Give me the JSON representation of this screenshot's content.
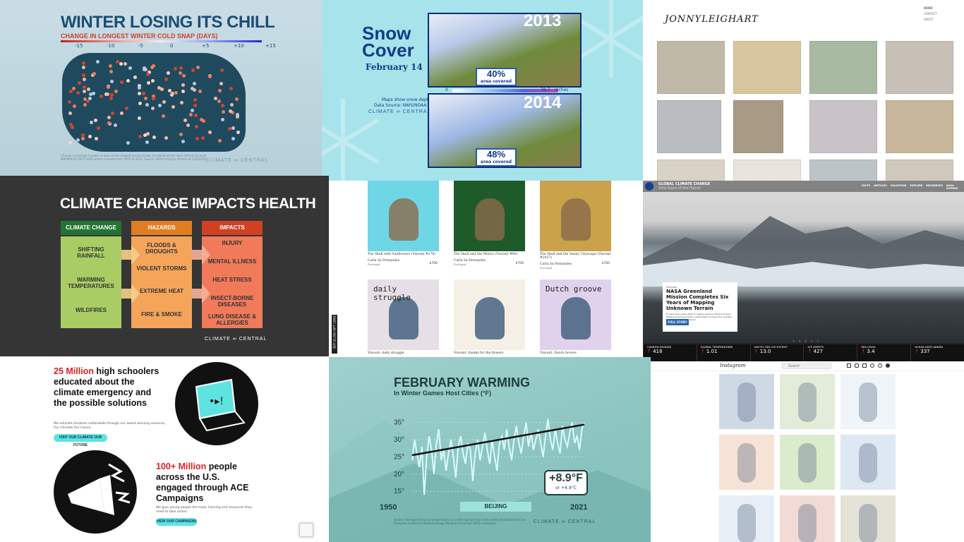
{
  "panel1": {
    "title": "WINTER LOSING ITS CHILL",
    "subtitle": "CHANGE IN LONGEST WINTER COLD SNAP (DAYS)",
    "scale": [
      "-15",
      "-10",
      "-5",
      "0",
      "+5",
      "+10",
      "+15"
    ],
    "note": "Change is average number of days of the longest annual streak of coldest winter days defined by local NORMAL(S) 1971-2020 winter covered from 1970 to 2021. Source: NOAA Analysis Produced 1/20/2022",
    "logo": "CLIMATE ∞ CENTRAL"
  },
  "panel2": {
    "title_line1": "Snow",
    "title_line2": "Cover",
    "date": "February 14",
    "year_top": "2013",
    "pct_top": "40%",
    "pct_top_label": "area covered",
    "legend_min": "0",
    "legend_max": "78.7",
    "legend_unit": "inches",
    "source_line1": "Maps show snow depth",
    "source_line2": "Data Source: NWS/NOAA",
    "logo": "CLIMATE ∞ CENTRAL",
    "year_bottom": "2014",
    "pct_bottom": "48%",
    "pct_bottom_label": "area covered"
  },
  "panel3": {
    "brand": "JONNYLEIGHART",
    "nav": [
      "WORK",
      "CONTACT",
      "ABOUT"
    ]
  },
  "panel4": {
    "title": "CLIMATE CHANGE IMPACTS HEALTH",
    "col1_header": "CLIMATE CHANGE",
    "col1_items": [
      "SHIFTING RAINFALL",
      "WARMING TEMPERATURES",
      "WILDFIRES"
    ],
    "col2_header": "HAZARDS",
    "col2_items": [
      "FLOODS & DROUGHTS",
      "VIOLENT STORMS",
      "EXTREME HEAT",
      "FIRE & SMOKE"
    ],
    "col3_header": "IMPACTS",
    "col3_items": [
      "INJURY",
      "MENTAL ILLNESS",
      "HEAT STRESS",
      "INSECT-BORNE DISEASES",
      "LUNG DISEASE & ALLERGIES"
    ],
    "logo": "CLIMATE ∞ CENTRAL",
    "colors": {
      "green": "#a9cd64",
      "orange": "#f5a55a",
      "red": "#f07a5a"
    }
  },
  "panel5": {
    "side_label": "BUY $1,000 GIFT CARD",
    "items": [
      {
        "title": "The Skull with Sunflowers (Vincent #276)",
        "artist": "Carla Sa Fernandes",
        "country": "Portugal",
        "price": "$700"
      },
      {
        "title": "The Skull and the Matrix (Vincent #80)",
        "artist": "Carla Sa Fernandes",
        "country": "Portugal",
        "price": "$700"
      },
      {
        "title": "The Skull and the Sunny Cityscape (Vincent #2027)",
        "artist": "Carla Sa Fernandes",
        "country": "Portugal",
        "price": "$700"
      },
      {
        "title": "Vincent, daily struggle",
        "artist": "",
        "country": "",
        "price": ""
      },
      {
        "title": "Vincent, thanks for the flowers",
        "artist": "",
        "country": "",
        "price": ""
      },
      {
        "title": "Vincent, Dutch Groove",
        "artist": "",
        "country": "",
        "price": ""
      }
    ],
    "art_text_4": "daily struggle",
    "art_text_6": "Dutch groove"
  },
  "panel6": {
    "site_title": "GLOBAL CLIMATE CHANGE",
    "site_sub": "Vital Signs of the Planet",
    "nav": [
      "FACTS",
      "ARTICLES",
      "SOLUTIONS",
      "EXPLORE",
      "RESOURCES",
      "NASA SCIENCE"
    ],
    "feature_tag": "FEATURES",
    "feature_title": "NASA Greenland Mission Completes Six Years of Mapping Unknown Terrain",
    "feature_body": "To learn how ocean water is melting glaciers, NASA's Oceans Melting Greenland mission extensively surveyed the coastline of the world's largest island.",
    "feature_button": "FULL STORY",
    "stats": [
      {
        "label": "CARBON DIOXIDE",
        "value": "418"
      },
      {
        "label": "GLOBAL TEMPERATURE",
        "value": "1.01"
      },
      {
        "label": "ARCTIC SEA ICE EXTENT",
        "value": "13.0"
      },
      {
        "label": "ICE SHEETS",
        "value": "427"
      },
      {
        "label": "SEA LEVEL",
        "value": "3.4"
      },
      {
        "label": "OCEAN HEAT ADDED",
        "value": "337"
      }
    ]
  },
  "panel7": {
    "stat1_bold": "25 Million",
    "stat1_rest": " high schoolers educated about the climate emergency and the possible solutions",
    "stat1_body": "We educate students nationwide through our award winning resource, Our Climate Our Future.",
    "stat1_button": "VISIT OUR CLIMATE OUR FUTURE",
    "stat2_bold": "100+ Million",
    "stat2_rest": " people across the U.S. engaged through ACE Campaigns",
    "stat2_body": "We give young people the tools, training and resources they need to take action.",
    "stat2_button": "VIEW OUR CAMPAIGNS"
  },
  "panel8": {
    "title": "FEBRUARY WARMING",
    "subtitle": "In Winter Games Host Cities (°F)",
    "city": "BEIJING",
    "change_f": "+8.9°F",
    "change_c": "or +4.9°C",
    "source": "Source: Average February temperatures in winter games host cities were calculated from the European Centre for Medium-Range Weather Forecasts' ERA5 reanalysis.",
    "logo": "CLIMATE ∞ CENTRAL",
    "chart_data": {
      "type": "line",
      "title": "FEBRUARY WARMING",
      "subtitle": "In Winter Games Host Cities (°F)",
      "x_ticks": [
        "1950",
        "2021"
      ],
      "y_ticks": [
        "35°",
        "30°",
        "25°",
        "20°",
        "15°"
      ],
      "ylim": [
        13,
        38
      ],
      "x": [
        1950,
        1951,
        1952,
        1953,
        1954,
        1955,
        1956,
        1957,
        1958,
        1959,
        1960,
        1961,
        1962,
        1963,
        1964,
        1965,
        1966,
        1967,
        1968,
        1969,
        1970,
        1971,
        1972,
        1973,
        1974,
        1975,
        1976,
        1977,
        1978,
        1979,
        1980,
        1981,
        1982,
        1983,
        1984,
        1985,
        1986,
        1987,
        1988,
        1989,
        1990,
        1991,
        1992,
        1993,
        1994,
        1995,
        1996,
        1997,
        1998,
        1999,
        2000,
        2001,
        2002,
        2003,
        2004,
        2005,
        2006,
        2007,
        2008,
        2009,
        2010,
        2011,
        2012,
        2013,
        2014,
        2015,
        2016,
        2017,
        2018,
        2019,
        2020,
        2021
      ],
      "series": [
        {
          "values": [
            24,
            30,
            26,
            22,
            28,
            14,
            25,
            31,
            27,
            20,
            29,
            33,
            24,
            27,
            21,
            26,
            30,
            25,
            19,
            28,
            31,
            26,
            23,
            29,
            27,
            18,
            26,
            30,
            24,
            28,
            32,
            27,
            23,
            30,
            25,
            21,
            29,
            31,
            27,
            33,
            28,
            24,
            30,
            34,
            29,
            26,
            31,
            35,
            28,
            32,
            27,
            30,
            33,
            29,
            25,
            31,
            36,
            30,
            27,
            33,
            29,
            26,
            34,
            30,
            28,
            32,
            35,
            29,
            31,
            27,
            33,
            35
          ]
        },
        {
          "values": [
            25.5,
            34.4
          ]
        }
      ]
    }
  },
  "panel9": {
    "brand": "Instagram",
    "search_placeholder": "Search"
  },
  "thumb_colors": [
    "#c0b9a8",
    "#d8c6a0",
    "#a7b9a0",
    "#c8c0b6",
    "#b9bcc0",
    "#a99a85",
    "#c9c3c8",
    "#c8b79a",
    "#d8d3c4",
    "#e8e4dd",
    "#bcc4c8",
    "#d0c8bc"
  ]
}
